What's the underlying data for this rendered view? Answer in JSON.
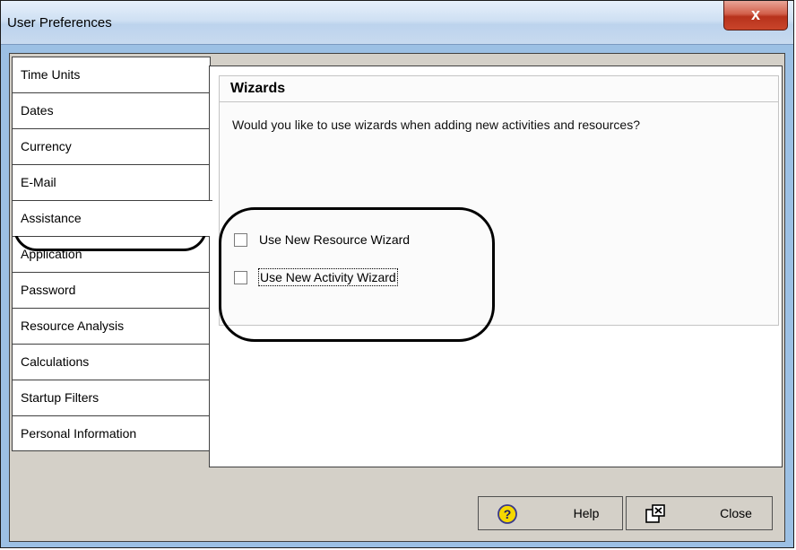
{
  "window": {
    "title": "User Preferences",
    "close_glyph": "x"
  },
  "tabs": [
    {
      "label": "Time Units"
    },
    {
      "label": "Dates"
    },
    {
      "label": "Currency"
    },
    {
      "label": "E-Mail"
    },
    {
      "label": "Assistance",
      "selected": true
    },
    {
      "label": "Application"
    },
    {
      "label": "Password"
    },
    {
      "label": "Resource Analysis"
    },
    {
      "label": "Calculations"
    },
    {
      "label": "Startup Filters"
    },
    {
      "label": "Personal Information"
    }
  ],
  "panel": {
    "header": "Wizards",
    "description": "Would you like to use wizards when adding new activities and resources?",
    "options": [
      {
        "label": "Use New Resource Wizard",
        "checked": false
      },
      {
        "label": "Use New Activity Wizard",
        "checked": false,
        "focused": true
      }
    ]
  },
  "buttons": {
    "help": {
      "label": "Help",
      "icon": "help-icon"
    },
    "close": {
      "label": "Close",
      "icon": "close-window-icon"
    }
  }
}
